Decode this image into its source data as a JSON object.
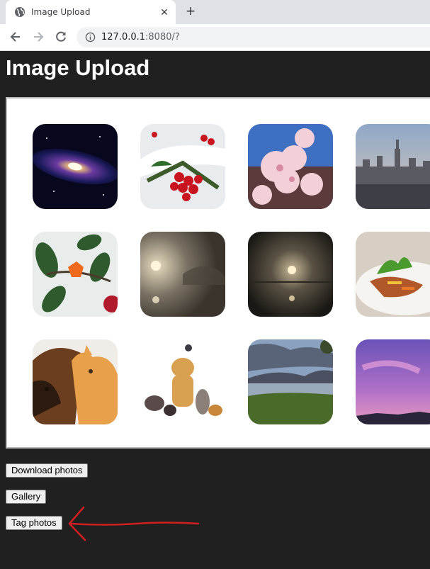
{
  "browser": {
    "tab_title": "Image Upload",
    "tab_close": "✕",
    "new_tab": "+",
    "url_host": "127.0.0.1",
    "url_rest": ":8080/?"
  },
  "page": {
    "title": "Image Upload"
  },
  "gallery": {
    "images": [
      {
        "subject": "galaxy"
      },
      {
        "subject": "red berries in snow"
      },
      {
        "subject": "pink blossoms"
      },
      {
        "subject": "city skyline"
      },
      {
        "subject": "orange flower plant"
      },
      {
        "subject": "foggy sun over lake"
      },
      {
        "subject": "dark misty sunrise"
      },
      {
        "subject": "plated food dish"
      },
      {
        "subject": "dog and cat cuddling"
      },
      {
        "subject": "group of pets"
      },
      {
        "subject": "lake landscape"
      },
      {
        "subject": "purple sunset sky"
      }
    ]
  },
  "buttons": {
    "download": "Download photos",
    "gallery": "Gallery",
    "tag": "Tag photos"
  },
  "annotation": {
    "arrow_color": "#d21f1f"
  }
}
